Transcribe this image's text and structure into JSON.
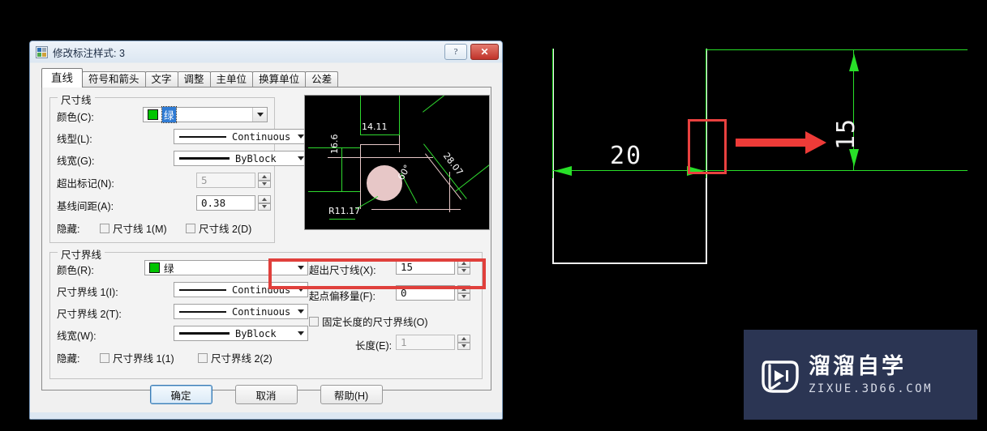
{
  "dialog": {
    "title": "修改标注样式: 3",
    "title_icon": "dimstyle-icon",
    "help_button": "?",
    "close_button": "✕",
    "tabs": [
      {
        "label": "直线",
        "active": true
      },
      {
        "label": "符号和箭头",
        "active": false
      },
      {
        "label": "文字",
        "active": false
      },
      {
        "label": "调整",
        "active": false
      },
      {
        "label": "主单位",
        "active": false
      },
      {
        "label": "换算单位",
        "active": false
      },
      {
        "label": "公差",
        "active": false
      }
    ],
    "dimension_line_group": {
      "title": "尺寸线",
      "color_label": "颜色(C):",
      "color_value": "绿",
      "color_swatch": "#00c400",
      "linetype_label": "线型(L):",
      "linetype_value": "Continuous",
      "lineweight_label": "线宽(G):",
      "lineweight_value": "ByBlock",
      "extend_beyond_label": "超出标记(N):",
      "extend_beyond_value": "5",
      "baseline_spacing_label": "基线间距(A):",
      "baseline_spacing_value": "0.38",
      "hide_label": "隐藏:",
      "hide_dim1": "尺寸线 1(M)",
      "hide_dim2": "尺寸线 2(D)"
    },
    "extension_line_group": {
      "title": "尺寸界线",
      "color_label": "颜色(R):",
      "color_value": "绿",
      "color_swatch": "#00c400",
      "ext1_label": "尺寸界线 1(I):",
      "ext1_value": "Continuous",
      "ext2_label": "尺寸界线 2(T):",
      "ext2_value": "Continuous",
      "lineweight_label": "线宽(W):",
      "lineweight_value": "ByBlock",
      "hide_label": "隐藏:",
      "hide_ext1": "尺寸界线 1(1)",
      "hide_ext2": "尺寸界线 2(2)",
      "extend_beyond_dimline_label": "超出尺寸线(X):",
      "extend_beyond_dimline_value": "15",
      "offset_from_origin_label": "起点偏移量(F):",
      "offset_from_origin_value": "0",
      "fixed_length_label": "固定长度的尺寸界线(O)",
      "length_label": "长度(E):",
      "length_value": "1",
      "highlight_color": "#e0403c"
    },
    "preview": {
      "dim_14": "14.11",
      "dim_16": "16.6",
      "dim_28": "28.07",
      "dim_60": "60°",
      "dim_r": "R11.17"
    },
    "buttons": {
      "ok": "确定",
      "cancel": "取消",
      "help": "帮助(H)"
    }
  },
  "cad": {
    "dim_horizontal": "20",
    "dim_vertical": "15",
    "geometry_color": "#f2f2f2",
    "dimension_color": "#28e028",
    "annotation_color": "#ee3b38"
  },
  "watermark": {
    "cn": "溜溜自学",
    "en": "ZIXUE.3D66.COM",
    "bg": "#2b3553"
  }
}
